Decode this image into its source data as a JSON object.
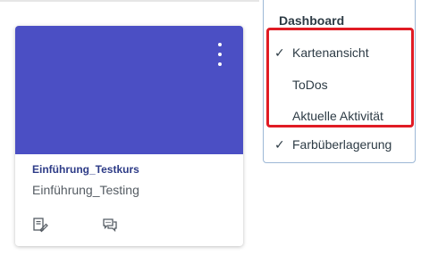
{
  "card": {
    "course_code": "Einführung_Testkurs",
    "course_name": "Einführung_Testing",
    "hero_color": "#4b4fc4",
    "icons": [
      "announcements-icon",
      "discussions-icon"
    ]
  },
  "dropdown": {
    "heading": "Dashboard",
    "items": [
      {
        "label": "Kartenansicht",
        "checked": true
      },
      {
        "label": "ToDos",
        "checked": false
      },
      {
        "label": "Aktuelle Aktivität",
        "checked": false
      },
      {
        "label": "Farbüberlagerung",
        "checked": true
      }
    ]
  },
  "colors": {
    "accent_link": "#2d3b87",
    "highlight_border": "#e01b24"
  }
}
